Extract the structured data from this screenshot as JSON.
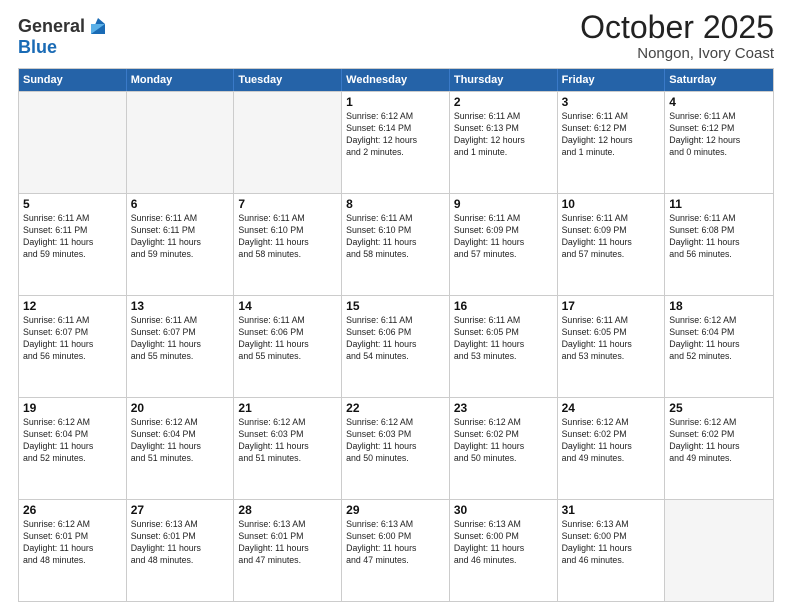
{
  "logo": {
    "general": "General",
    "blue": "Blue"
  },
  "title": {
    "month": "October 2025",
    "location": "Nongon, Ivory Coast"
  },
  "header_days": [
    "Sunday",
    "Monday",
    "Tuesday",
    "Wednesday",
    "Thursday",
    "Friday",
    "Saturday"
  ],
  "weeks": [
    [
      {
        "day": "",
        "info": ""
      },
      {
        "day": "",
        "info": ""
      },
      {
        "day": "",
        "info": ""
      },
      {
        "day": "1",
        "info": "Sunrise: 6:12 AM\nSunset: 6:14 PM\nDaylight: 12 hours\nand 2 minutes."
      },
      {
        "day": "2",
        "info": "Sunrise: 6:11 AM\nSunset: 6:13 PM\nDaylight: 12 hours\nand 1 minute."
      },
      {
        "day": "3",
        "info": "Sunrise: 6:11 AM\nSunset: 6:12 PM\nDaylight: 12 hours\nand 1 minute."
      },
      {
        "day": "4",
        "info": "Sunrise: 6:11 AM\nSunset: 6:12 PM\nDaylight: 12 hours\nand 0 minutes."
      }
    ],
    [
      {
        "day": "5",
        "info": "Sunrise: 6:11 AM\nSunset: 6:11 PM\nDaylight: 11 hours\nand 59 minutes."
      },
      {
        "day": "6",
        "info": "Sunrise: 6:11 AM\nSunset: 6:11 PM\nDaylight: 11 hours\nand 59 minutes."
      },
      {
        "day": "7",
        "info": "Sunrise: 6:11 AM\nSunset: 6:10 PM\nDaylight: 11 hours\nand 58 minutes."
      },
      {
        "day": "8",
        "info": "Sunrise: 6:11 AM\nSunset: 6:10 PM\nDaylight: 11 hours\nand 58 minutes."
      },
      {
        "day": "9",
        "info": "Sunrise: 6:11 AM\nSunset: 6:09 PM\nDaylight: 11 hours\nand 57 minutes."
      },
      {
        "day": "10",
        "info": "Sunrise: 6:11 AM\nSunset: 6:09 PM\nDaylight: 11 hours\nand 57 minutes."
      },
      {
        "day": "11",
        "info": "Sunrise: 6:11 AM\nSunset: 6:08 PM\nDaylight: 11 hours\nand 56 minutes."
      }
    ],
    [
      {
        "day": "12",
        "info": "Sunrise: 6:11 AM\nSunset: 6:07 PM\nDaylight: 11 hours\nand 56 minutes."
      },
      {
        "day": "13",
        "info": "Sunrise: 6:11 AM\nSunset: 6:07 PM\nDaylight: 11 hours\nand 55 minutes."
      },
      {
        "day": "14",
        "info": "Sunrise: 6:11 AM\nSunset: 6:06 PM\nDaylight: 11 hours\nand 55 minutes."
      },
      {
        "day": "15",
        "info": "Sunrise: 6:11 AM\nSunset: 6:06 PM\nDaylight: 11 hours\nand 54 minutes."
      },
      {
        "day": "16",
        "info": "Sunrise: 6:11 AM\nSunset: 6:05 PM\nDaylight: 11 hours\nand 53 minutes."
      },
      {
        "day": "17",
        "info": "Sunrise: 6:11 AM\nSunset: 6:05 PM\nDaylight: 11 hours\nand 53 minutes."
      },
      {
        "day": "18",
        "info": "Sunrise: 6:12 AM\nSunset: 6:04 PM\nDaylight: 11 hours\nand 52 minutes."
      }
    ],
    [
      {
        "day": "19",
        "info": "Sunrise: 6:12 AM\nSunset: 6:04 PM\nDaylight: 11 hours\nand 52 minutes."
      },
      {
        "day": "20",
        "info": "Sunrise: 6:12 AM\nSunset: 6:04 PM\nDaylight: 11 hours\nand 51 minutes."
      },
      {
        "day": "21",
        "info": "Sunrise: 6:12 AM\nSunset: 6:03 PM\nDaylight: 11 hours\nand 51 minutes."
      },
      {
        "day": "22",
        "info": "Sunrise: 6:12 AM\nSunset: 6:03 PM\nDaylight: 11 hours\nand 50 minutes."
      },
      {
        "day": "23",
        "info": "Sunrise: 6:12 AM\nSunset: 6:02 PM\nDaylight: 11 hours\nand 50 minutes."
      },
      {
        "day": "24",
        "info": "Sunrise: 6:12 AM\nSunset: 6:02 PM\nDaylight: 11 hours\nand 49 minutes."
      },
      {
        "day": "25",
        "info": "Sunrise: 6:12 AM\nSunset: 6:02 PM\nDaylight: 11 hours\nand 49 minutes."
      }
    ],
    [
      {
        "day": "26",
        "info": "Sunrise: 6:12 AM\nSunset: 6:01 PM\nDaylight: 11 hours\nand 48 minutes."
      },
      {
        "day": "27",
        "info": "Sunrise: 6:13 AM\nSunset: 6:01 PM\nDaylight: 11 hours\nand 48 minutes."
      },
      {
        "day": "28",
        "info": "Sunrise: 6:13 AM\nSunset: 6:01 PM\nDaylight: 11 hours\nand 47 minutes."
      },
      {
        "day": "29",
        "info": "Sunrise: 6:13 AM\nSunset: 6:00 PM\nDaylight: 11 hours\nand 47 minutes."
      },
      {
        "day": "30",
        "info": "Sunrise: 6:13 AM\nSunset: 6:00 PM\nDaylight: 11 hours\nand 46 minutes."
      },
      {
        "day": "31",
        "info": "Sunrise: 6:13 AM\nSunset: 6:00 PM\nDaylight: 11 hours\nand 46 minutes."
      },
      {
        "day": "",
        "info": ""
      }
    ]
  ]
}
